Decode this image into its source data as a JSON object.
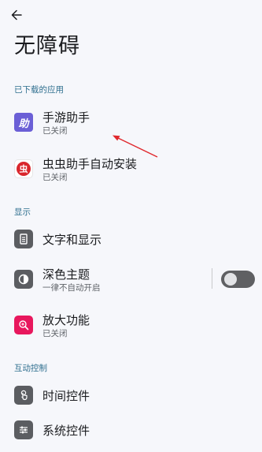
{
  "header": {
    "back_icon": "arrow-left-icon",
    "title": "无障碍"
  },
  "sections": {
    "downloaded": {
      "header": "已下载的应用",
      "items": [
        {
          "label": "手游助手",
          "sub": "已关闭",
          "icon": "shouyou-app-icon",
          "icon_text": "助",
          "color": "#6b5fd6"
        },
        {
          "label": "虫虫助手自动安装",
          "sub": "已关闭",
          "icon": "chongchong-app-icon",
          "icon_text": "虫",
          "color": "#d9262c"
        }
      ]
    },
    "display": {
      "header": "显示",
      "items": [
        {
          "label": "文字和显示",
          "icon": "text-display-icon",
          "color": "#5b5d61"
        },
        {
          "label": "深色主题",
          "sub": "一律不自动开启",
          "icon": "dark-theme-icon",
          "color": "#5b5d61"
        },
        {
          "label": "放大功能",
          "sub": "已关闭",
          "icon": "magnifier-icon",
          "color": "#e8175d"
        }
      ]
    },
    "interaction": {
      "header": "互动控制",
      "items": [
        {
          "label": "时间控件",
          "icon": "touch-timing-icon",
          "color": "#5b5d61"
        },
        {
          "label": "系统控件",
          "icon": "system-controls-icon",
          "color": "#5b5d61"
        }
      ]
    }
  },
  "dark_theme_toggle": {
    "on": false
  }
}
